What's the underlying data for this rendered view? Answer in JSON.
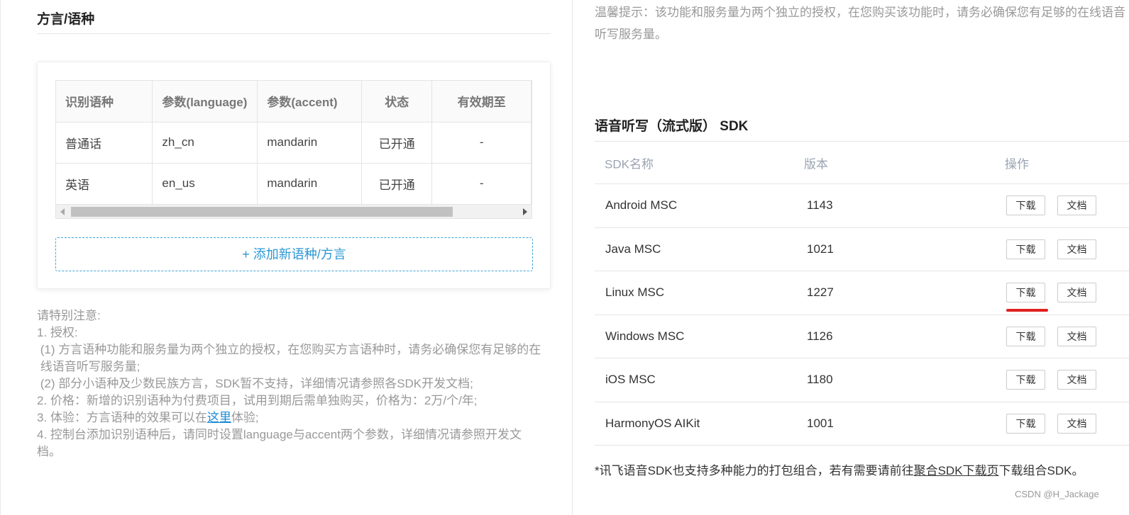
{
  "left": {
    "title": "方言/语种",
    "table": {
      "headers": [
        "识别语种",
        "参数(language)",
        "参数(accent)",
        "状态",
        "有效期至"
      ],
      "rows": [
        [
          "普通话",
          "zh_cn",
          "mandarin",
          "已开通",
          "-"
        ],
        [
          "英语",
          "en_us",
          "mandarin",
          "已开通",
          "-"
        ]
      ]
    },
    "add_button": "+ 添加新语种/方言",
    "notes": {
      "heading": "请特别注意:",
      "n1": "1. 授权:",
      "n1a": " (1) 方言语种功能和服务量为两个独立的授权，在您购买方言语种时，请务必确保您有足够的在\n 线语音听写服务量;",
      "n1b": " (2) 部分小语种及少数民族方言，SDK暂不支持，详细情况请参照各SDK开发文档;",
      "n2": "2. 价格：新增的识别语种为付费项目，试用到期后需单独购买，价格为：2万/个/年;",
      "n3_pre": "3. 体验：方言语种的效果可以在",
      "n3_link": "这里",
      "n3_post": "体验;",
      "n4": "4. 控制台添加识别语种后，请同时设置language与accent两个参数，详细情况请参照开发文\n档。"
    }
  },
  "right": {
    "tip": "温馨提示：该功能和服务量为两个独立的授权，在您购买该功能时，请务必确保您有足够的在线语音听写服务量。",
    "sdk_title": "语音听写（流式版） SDK",
    "headers": {
      "name": "SDK名称",
      "version": "版本",
      "action": "操作"
    },
    "rows": [
      {
        "name": "Android MSC",
        "version": "1143"
      },
      {
        "name": "Java MSC",
        "version": "1021"
      },
      {
        "name": "Linux MSC",
        "version": "1227"
      },
      {
        "name": "Windows MSC",
        "version": "1126"
      },
      {
        "name": "iOS MSC",
        "version": "1180"
      },
      {
        "name": "HarmonyOS AIKit",
        "version": "1001"
      }
    ],
    "download_label": "下载",
    "doc_label": "文档",
    "footnote_pre": "*讯飞语音SDK也支持多种能力的打包组合，若有需要请前往",
    "footnote_link": "聚合SDK下载页",
    "footnote_post": "下载组合SDK。"
  },
  "watermark": "CSDN @H_Jackage",
  "colors": {
    "accent": "#2b97d4",
    "annotation": "#e02020"
  }
}
